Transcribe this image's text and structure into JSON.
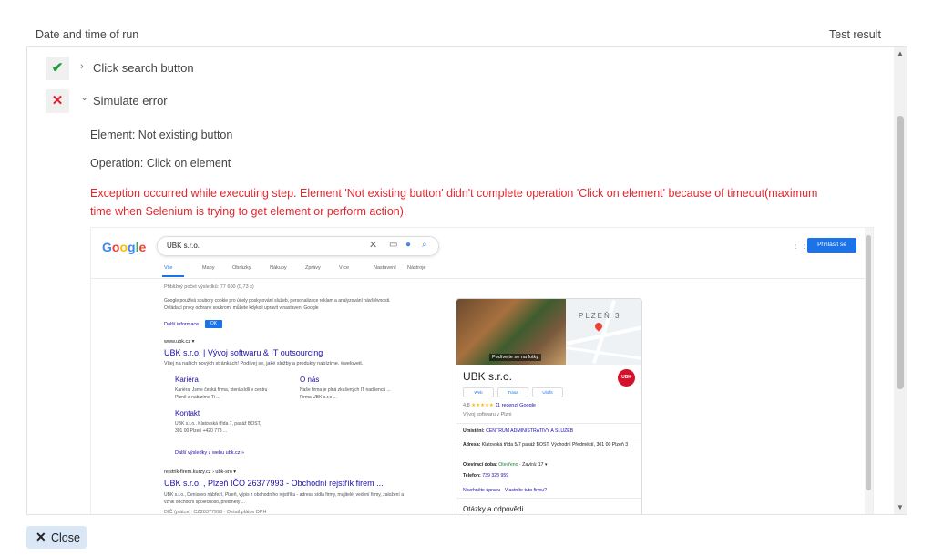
{
  "header": {
    "left_col": "Date and time of run",
    "right_col": "Test result"
  },
  "steps": [
    {
      "status": "pass",
      "status_glyph": "✔",
      "chevron": "›",
      "label": "Click search button"
    },
    {
      "status": "fail",
      "status_glyph": "✕",
      "chevron": "⌄",
      "label": "Simulate error"
    }
  ],
  "details": {
    "element": "Element: Not existing button",
    "operation": "Operation: Click on element",
    "error": "Exception occurred while executing step. Element 'Not existing button' didn't complete operation 'Click on element' because of timeout(maximum time when Selenium is trying to get element or perform action)."
  },
  "screenshot": {
    "logo_letters": [
      "G",
      "o",
      "o",
      "g",
      "l",
      "e"
    ],
    "query": "UBK s.r.o.",
    "signin": "Přihlásit se",
    "tabs": [
      "Vše",
      "Mapy",
      "Obrázky",
      "Nákupy",
      "Zprávy",
      "Více",
      "Nastavení",
      "Nástroje"
    ],
    "result_count": "Přibližný počet výsledků: 77 600 (0,73 s)",
    "cookie_text": "Google používá soubory cookie pro účely poskytování služeb, personalizace reklam a analyzování návštěvnosti. Ovládací prvky ochrany soukromí můžete kdykoli upravit v nastavení Google",
    "cookie_more": "Další informace",
    "cookie_ok": "OK",
    "result1": {
      "url": "www.ubk.cz ▾",
      "title": "UBK s.r.o. | Vývoj softwaru & IT outsourcing",
      "snippet": "Vítej na našich nových stránkách! Podívej se, jaké služby a produkty nabízíme. #weloveit.",
      "sublinks": [
        {
          "title": "Kariéra",
          "text": "Kariéra. Jsme česká firma, která sídlí v centru Plzně a nabízíme Ti ..."
        },
        {
          "title": "O nás",
          "text": "Naše firma je plná zkušených IT nadšenců ... Firma UBK s.r.o ..."
        },
        {
          "title": "Kontakt",
          "text": "UBK s.r.o.. Klatovská třída 7, pasáž BOST, 301 00 Plzeň +420 773 ..."
        }
      ],
      "more": "Další výsledky z webu ubk.cz »"
    },
    "result2": {
      "url": "rejstrik-firem.kurzy.cz › ubk-sro ▾",
      "title": "UBK s.r.o. , Plzeň IČO 26377993 - Obchodní rejstřík firem ...",
      "snippet": "UBK s.r.o., Denisovo nábřeží, Plzeň, výpis z obchodního rejstříku - adresa sídla firmy, majitelé, vedení firmy, založení a vznik obchodní společnosti, předměty ...",
      "extra": "DIČ (plátce): CZ26377993 · Detail plátce DPH"
    },
    "knowledge_panel": {
      "photo_caption": "Podívejte se na fotky",
      "map_city": "PLZEŇ 3",
      "name": "UBK s.r.o.",
      "logo_text": "UBK",
      "buttons": [
        "Web",
        "Trasa",
        "Uložit"
      ],
      "rating_value": "4,8",
      "rating_stars": "★★★★★",
      "rating_reviews": "11 recenzí Google",
      "category": "Vývoj softwaru v Plzni",
      "location_label": "Umístění:",
      "location_value": "CENTRUM ADMINISTRATIVY A SLUŽEB",
      "address_label": "Adresa:",
      "address_value": "Klatovská třída 5/7 pasáž BOST, Východní Předměstí, 301 00 Plzeň 3",
      "hours_label": "Otevírací doba:",
      "hours_open": "Otevřeno",
      "hours_rest": "· Zavírá: 17 ▾",
      "phone_label": "Telefon:",
      "phone_value": "739 323 959",
      "edit_link": "Navrhněte úpravu · Vlastníte tuto firmu?",
      "qa": "Otázky a odpovědi"
    }
  },
  "footer": {
    "close_icon": "✕",
    "close_label": "Close"
  },
  "colors": {
    "pass": "#1f9d3a",
    "fail": "#e0202e",
    "error_text": "#e3262e",
    "close_bg": "#d9e7f6"
  }
}
